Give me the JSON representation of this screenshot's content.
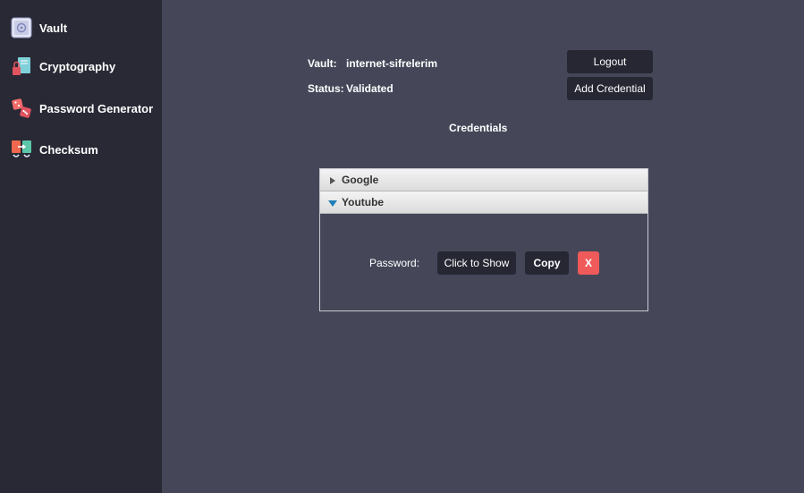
{
  "sidebar": {
    "items": [
      {
        "label": "Vault",
        "icon": "vault-icon"
      },
      {
        "label": "Cryptography",
        "icon": "cryptography-icon"
      },
      {
        "label": "Password Generator",
        "icon": "dice-icon"
      },
      {
        "label": "Checksum",
        "icon": "checksum-icon"
      }
    ]
  },
  "vault_info": {
    "vault_label": "Vault:",
    "vault_name": "internet-sifrelerim",
    "status_label": "Status:",
    "status_value": "Validated"
  },
  "actions": {
    "logout_label": "Logout",
    "add_credential_label": "Add Credential"
  },
  "credentials": {
    "heading": "Credentials",
    "entries": [
      {
        "name": "Google",
        "expanded": false
      },
      {
        "name": "Youtube",
        "expanded": true
      }
    ],
    "expanded_entry": {
      "password_label": "Password:",
      "show_label": "Click to Show",
      "copy_label": "Copy",
      "delete_label": "X"
    }
  },
  "colors": {
    "sidebar_bg": "#282935",
    "main_bg": "#454759",
    "button_bg": "#262733",
    "delete_button": "#f05a5a",
    "expand_arrow": "#1e7fb8"
  }
}
